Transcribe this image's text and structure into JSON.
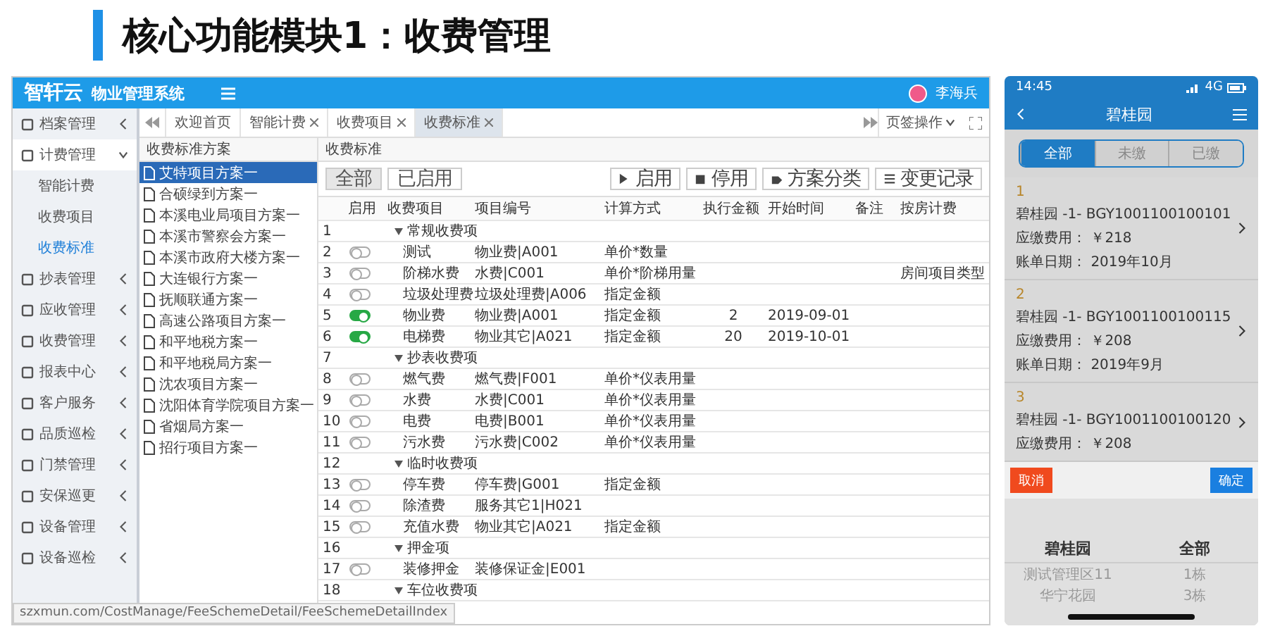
{
  "slide_title": "核心功能模块1：收费管理",
  "admin": {
    "brand": "智轩云",
    "system": "物业管理系统",
    "user": "李海兵",
    "sidebar": [
      {
        "label": "档案管理",
        "expanded": false
      },
      {
        "label": "计费管理",
        "expanded": true,
        "children": [
          {
            "label": "智能计费",
            "selected": false
          },
          {
            "label": "收费项目",
            "selected": false
          },
          {
            "label": "收费标准",
            "selected": true
          }
        ]
      },
      {
        "label": "抄表管理",
        "expanded": false
      },
      {
        "label": "应收管理",
        "expanded": false
      },
      {
        "label": "收费管理",
        "expanded": false
      },
      {
        "label": "报表中心",
        "expanded": false
      },
      {
        "label": "客户服务",
        "expanded": false
      },
      {
        "label": "品质巡检",
        "expanded": false
      },
      {
        "label": "门禁管理",
        "expanded": false
      },
      {
        "label": "安保巡更",
        "expanded": false
      },
      {
        "label": "设备管理",
        "expanded": false
      },
      {
        "label": "设备巡检",
        "expanded": false
      }
    ],
    "tabs": [
      {
        "label": "欢迎首页",
        "closable": false,
        "selected": false
      },
      {
        "label": "智能计费",
        "closable": true,
        "selected": false
      },
      {
        "label": "收费项目",
        "closable": true,
        "selected": false
      },
      {
        "label": "收费标准",
        "closable": true,
        "selected": true
      }
    ],
    "tab_menu": "页签操作",
    "tree_title": "收费标准方案",
    "tree": [
      {
        "label": "艾特项目方案一",
        "selected": true
      },
      {
        "label": "合硕绿到方案一",
        "selected": false
      },
      {
        "label": "本溪电业局项目方案一",
        "selected": false
      },
      {
        "label": "本溪市警察会方案一",
        "selected": false
      },
      {
        "label": "本溪市政府大楼方案一",
        "selected": false
      },
      {
        "label": "大连银行方案一",
        "selected": false
      },
      {
        "label": "抚顺联通方案一",
        "selected": false
      },
      {
        "label": "高速公路项目方案一",
        "selected": false
      },
      {
        "label": "和平地税方案一",
        "selected": false
      },
      {
        "label": "和平地税局方案一",
        "selected": false
      },
      {
        "label": "沈农项目方案一",
        "selected": false
      },
      {
        "label": "沈阳体育学院项目方案一",
        "selected": false
      },
      {
        "label": "省烟局方案一",
        "selected": false
      },
      {
        "label": "招行项目方案一",
        "selected": false
      }
    ],
    "panel_title": "收费标准",
    "filters": [
      {
        "label": "全部",
        "selected": true
      },
      {
        "label": "已启用",
        "selected": false
      }
    ],
    "actions": [
      "启用",
      "停用",
      "方案分类",
      "变更记录"
    ],
    "columns": [
      "启用",
      "收费项目",
      "项目编号",
      "计算方式",
      "执行金额",
      "开始时间",
      "备注",
      "按房计费"
    ],
    "rows": [
      {
        "kind": "group",
        "no": "1",
        "item": "常规收费项"
      },
      {
        "kind": "item",
        "no": "2",
        "enabled": false,
        "item": "测试",
        "code": "物业费|A001",
        "method": "单价*数量"
      },
      {
        "kind": "item",
        "no": "3",
        "enabled": false,
        "item": "阶梯水费",
        "code": "水费|C001",
        "method": "单价*阶梯用量",
        "by_room": "房间项目类型"
      },
      {
        "kind": "item",
        "no": "4",
        "enabled": false,
        "item": "垃圾处理费",
        "code": "垃圾处理费|A006",
        "method": "指定金额"
      },
      {
        "kind": "item",
        "no": "5",
        "enabled": true,
        "item": "物业费",
        "code": "物业费|A001",
        "method": "指定金额",
        "amount": "2",
        "start": "2019-09-01"
      },
      {
        "kind": "item",
        "no": "6",
        "enabled": true,
        "item": "电梯费",
        "code": "物业其它|A021",
        "method": "指定金额",
        "amount": "20",
        "start": "2019-10-01"
      },
      {
        "kind": "group",
        "no": "7",
        "item": "抄表收费项"
      },
      {
        "kind": "item",
        "no": "8",
        "enabled": false,
        "item": "燃气费",
        "code": "燃气费|F001",
        "method": "单价*仪表用量"
      },
      {
        "kind": "item",
        "no": "9",
        "enabled": false,
        "item": "水费",
        "code": "水费|C001",
        "method": "单价*仪表用量"
      },
      {
        "kind": "item",
        "no": "10",
        "enabled": false,
        "item": "电费",
        "code": "电费|B001",
        "method": "单价*仪表用量"
      },
      {
        "kind": "item",
        "no": "11",
        "enabled": false,
        "item": "污水费",
        "code": "污水费|C002",
        "method": "单价*仪表用量"
      },
      {
        "kind": "group",
        "no": "12",
        "item": "临时收费项"
      },
      {
        "kind": "item",
        "no": "13",
        "enabled": false,
        "item": "停车费",
        "code": "停车费|G001",
        "method": "指定金额"
      },
      {
        "kind": "item",
        "no": "14",
        "enabled": false,
        "item": "除渣费",
        "code": "服务其它1|H021"
      },
      {
        "kind": "item",
        "no": "15",
        "enabled": false,
        "item": "充值水费",
        "code": "物业其它|A021",
        "method": "指定金额"
      },
      {
        "kind": "group",
        "no": "16",
        "item": "押金项"
      },
      {
        "kind": "item",
        "no": "17",
        "enabled": false,
        "item": "装修押金",
        "code": "装修保证金|E001"
      },
      {
        "kind": "group",
        "no": "18",
        "item": "车位收费项"
      }
    ],
    "status_url": "szxmun.com/CostManage/FeeSchemeDetail/FeeSchemeDetailIndex"
  },
  "phone": {
    "time": "14:45",
    "network": "4G",
    "title": "碧桂园",
    "segments": [
      {
        "label": "全部",
        "selected": true
      },
      {
        "label": "未缴",
        "selected": false
      },
      {
        "label": "已缴",
        "selected": false
      }
    ],
    "bills": [
      {
        "index": "1",
        "house": "碧桂园 -1- BGY1001100100101",
        "due_label": "应缴费用：",
        "due": "￥218",
        "date_label": "账单日期：",
        "date": "2019年10月"
      },
      {
        "index": "2",
        "house": "碧桂园 -1- BGY1001100100115",
        "due_label": "应缴费用：",
        "due": "￥208",
        "date_label": "账单日期：",
        "date": "2019年9月"
      },
      {
        "index": "3",
        "house": "碧桂园 -1- BGY1001100100120",
        "due_label": "应缴费用：",
        "due": "￥208"
      }
    ],
    "picker": {
      "cancel": "取消",
      "confirm": "确定",
      "columns": [
        {
          "header": "碧桂园",
          "options": [
            "测试管理区11",
            "华宁花园"
          ]
        },
        {
          "header": "全部",
          "options": [
            "1栋",
            "3栋"
          ]
        }
      ]
    }
  }
}
